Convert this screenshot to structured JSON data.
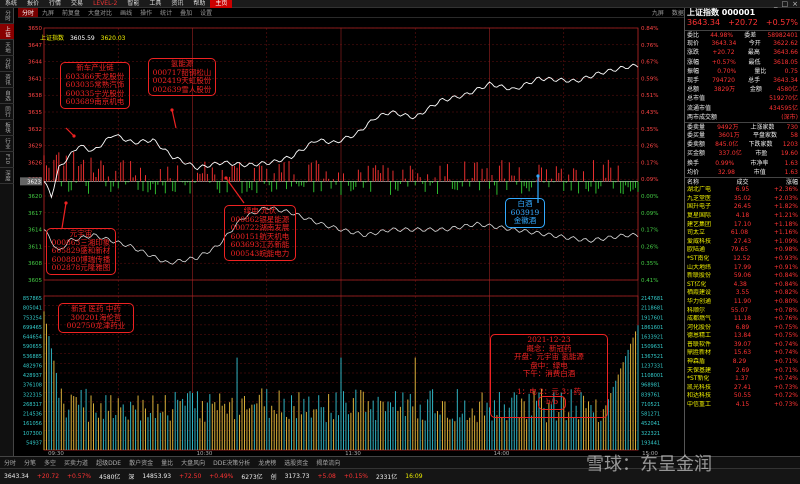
{
  "menubar": {
    "items": [
      "系统",
      "报价",
      "行情",
      "交易",
      "LEVEL-2",
      "智能",
      "工具",
      "资讯",
      "帮助",
      "主页"
    ],
    "controls": [
      "_",
      "□",
      "×"
    ]
  },
  "toolbar": {
    "items": [
      "分时",
      "九屏",
      "前复盘",
      "大盘对比",
      "画线",
      "操作",
      "统计",
      "叠加",
      "设置"
    ],
    "right_items": [
      "九屏",
      "数据备基",
      "大盘对比",
      "画线",
      "简单自选",
      "沙"
    ]
  },
  "leftbar": {
    "items": [
      "分时",
      "上证指数",
      "天地",
      "分析",
      "资讯",
      "自选",
      "同行",
      "板块",
      "行业",
      "F10",
      "深度"
    ]
  },
  "ticker": {
    "name": "上证指数",
    "parts": [
      "3605.59",
      "3620.03"
    ]
  },
  "price_axis": {
    "left": [
      "3650",
      "3647",
      "3644",
      "3641",
      "3638",
      "3635",
      "3632",
      "3629",
      "3626",
      "3623",
      "3620",
      "3617",
      "3614",
      "3611",
      "3608",
      "3605"
    ],
    "right": [
      "0.84%",
      "0.76%",
      "0.67%",
      "0.59%",
      "0.51%",
      "0.43%",
      "0.35%",
      "0.26%",
      "0.17%",
      "0.09%",
      "0.00%",
      "0.09%",
      "0.17%",
      "0.26%",
      "0.35%",
      "0.41%"
    ],
    "highlight": "3623"
  },
  "volume_axis": {
    "left": [
      "857865",
      "805041",
      "753254",
      "699465",
      "644654",
      "590655",
      "536885",
      "482976",
      "428937",
      "376108",
      "322315",
      "268317",
      "214536",
      "161056",
      "107300",
      "54937"
    ],
    "right": [
      "2147681",
      "2118681",
      "1917601",
      "1861601",
      "1633921",
      "1509631",
      "1367521",
      "1237331",
      "1108001",
      "968981",
      "839761",
      "710521",
      "581271",
      "452041",
      "322321",
      "193441"
    ]
  },
  "time_axis": [
    "09:30",
    "10:30",
    "11:30",
    "14:00",
    "15:00"
  ],
  "annotations": {
    "car": "新车产业链\n603366天龙股份\n603035常熟汽饰\n600335宁光股份\n603689南京机电",
    "hydrogen": "氢能源\n000717韶钢松山\n002419天虹股份\n002639雪人股份",
    "metaverse": "元宇宙\n000863三湘印象\n605829盛和新材\n600880博瑞传播\n002878元隆雅图",
    "pharma": "新冠 医药 中药\n300201海伦哲\n002750龙津药业",
    "green": "绿电 光伏\n000862银星能源\n000722湖南发展\n600151航天机电\n603693江苏新能\n000543皖能电力",
    "baijiu": "白酒\n603919\n金徽酒",
    "summary": "2021-12-23\n概念：新冠药\n开盘：元宇宙 氢能源\n盘中：绿电\n下午：消费白酒\n\n1：电 2：元 3：药",
    "page": "b/b"
  },
  "right_panel": {
    "title": "上证指数 000001",
    "price": "3643.34",
    "change": "+20.72",
    "pct": "+0.57%",
    "rows": [
      {
        "l": "委比",
        "lv": "44.98%",
        "r": "委差",
        "rv": "58982401"
      },
      {
        "l": "现价",
        "lv": "3643.34",
        "r": "今开",
        "rv": "3622.62"
      },
      {
        "l": "涨跌",
        "lv": "+20.72",
        "r": "最高",
        "rv": "3643.66"
      },
      {
        "l": "涨幅",
        "lv": "+0.57%",
        "r": "最低",
        "rv": "3618.05"
      },
      {
        "l": "振幅",
        "lv": "0.70%",
        "r": "量比",
        "rv": "0.75"
      },
      {
        "l": "现手",
        "lv": "794720",
        "r": "总手",
        "rv": "3643.34"
      },
      {
        "l": "总额",
        "lv": "3829万",
        "r": "金额",
        "rv": "4580亿"
      },
      {
        "l": "总市值",
        "lv": "",
        "r": "",
        "rv": "519270亿"
      },
      {
        "l": "流通市值",
        "lv": "",
        "r": "",
        "rv": "434595亿"
      },
      {
        "l": "两市成交额",
        "lv": "",
        "r": "",
        "rv": "(深市)"
      }
    ],
    "stats": [
      {
        "l": "委卖量",
        "lv": "9492万",
        "r": "上涨家数",
        "rv": "730"
      },
      {
        "l": "委买量",
        "lv": "3601万",
        "r": "平盘家数",
        "rv": "58"
      },
      {
        "l": "委卖额",
        "lv": "845.0亿",
        "r": "下跌家数",
        "rv": "1203"
      },
      {
        "l": "买金额",
        "lv": "337.0亿",
        "r": "市盈",
        "rv": "19.60"
      },
      {
        "l": "换手",
        "lv": "0.99%",
        "r": "市净率",
        "rv": "1.63"
      },
      {
        "l": "均价",
        "lv": "32.98",
        "r": "市值",
        "rv": "1.63"
      }
    ],
    "list_header": [
      "名称",
      "成交",
      "涨幅"
    ],
    "list": [
      {
        "n": "湖北广电",
        "v": "6.95",
        "p": "+2.36%"
      },
      {
        "n": "九芝堂医",
        "v": "35.02",
        "p": "+2.03%"
      },
      {
        "n": "国升电子",
        "v": "26.45",
        "p": "+1.82%"
      },
      {
        "n": "复星国际",
        "v": "4.18",
        "p": "+1.21%"
      },
      {
        "n": "建艺集团",
        "v": "17.10",
        "p": "+1.18%"
      },
      {
        "n": "司太立",
        "v": "61.08",
        "p": "+1.16%"
      },
      {
        "n": "爱威科技",
        "v": "27.43",
        "p": "+1.09%"
      },
      {
        "n": "欧陆通",
        "v": "79.65",
        "p": "+0.98%"
      },
      {
        "n": "*ST南化",
        "v": "12.52",
        "p": "+0.93%"
      },
      {
        "n": "山大地纬",
        "v": "17.99",
        "p": "+0.91%"
      },
      {
        "n": "新联股份",
        "v": "59.06",
        "p": "+0.84%"
      },
      {
        "n": "ST亿化",
        "v": "4.38",
        "p": "+0.84%"
      },
      {
        "n": "栖霞建设",
        "v": "3.55",
        "p": "+0.82%"
      },
      {
        "n": "华力创通",
        "v": "11.90",
        "p": "+0.80%"
      },
      {
        "n": "科顺尔",
        "v": "55.07",
        "p": "+0.78%"
      },
      {
        "n": "成都燃气",
        "v": "11.18",
        "p": "+0.76%"
      },
      {
        "n": "河化股份",
        "v": "6.89",
        "p": "+0.75%"
      },
      {
        "n": "德恩精工",
        "v": "13.84",
        "p": "+0.75%"
      },
      {
        "n": "普联软件",
        "v": "39.07",
        "p": "+0.74%"
      },
      {
        "n": "鼎胜新材",
        "v": "15.63",
        "p": "+0.74%"
      },
      {
        "n": "神森盾",
        "v": "8.29",
        "p": "+0.71%"
      },
      {
        "n": "天保基建",
        "v": "2.69",
        "p": "+0.71%"
      },
      {
        "n": "*ST新化",
        "v": "1.37",
        "p": "+0.74%"
      },
      {
        "n": "凯光科技",
        "v": "27.41",
        "p": "+0.73%"
      },
      {
        "n": "和达科技",
        "v": "50.55",
        "p": "+0.72%"
      },
      {
        "n": "中信重工",
        "v": "4.15",
        "p": "+0.73%"
      }
    ]
  },
  "bottom_tabs": [
    "分时",
    "分笔",
    "多空",
    "买卖力道",
    "超级DDE",
    "散户资金",
    "量比",
    "大盘风向",
    "DDE决策分析",
    "龙虎榜",
    "选股资金",
    "揭单流向"
  ],
  "status": {
    "items": [
      {
        "t": "3643.34",
        "c": "white"
      },
      {
        "t": "+20.72",
        "c": "red"
      },
      {
        "t": "+0.57%",
        "c": "red"
      },
      {
        "t": "4580亿",
        "c": "white"
      },
      {
        "t": "深",
        "c": "white"
      },
      {
        "t": "14853.93",
        "c": "white"
      },
      {
        "t": "+72.50",
        "c": "red"
      },
      {
        "t": "+0.49%",
        "c": "red"
      },
      {
        "t": "6273亿",
        "c": "white"
      },
      {
        "t": "创",
        "c": "white"
      },
      {
        "t": "3173.73",
        "c": "white"
      },
      {
        "t": "+5.08",
        "c": "red"
      },
      {
        "t": "+0.15%",
        "c": "red"
      },
      {
        "t": "2331亿",
        "c": "white"
      },
      {
        "t": "16:09",
        "c": "yellow"
      }
    ]
  },
  "watermark": "雪球：东呈金润",
  "colors": {
    "up": "#ff3333",
    "down": "#33cc33",
    "line_price": "#ffffff",
    "line_avg": "#ffff00",
    "grid": "#661111"
  },
  "chart_data": {
    "type": "line",
    "x_unit": "minute index 0-240",
    "ylim": [
      3605,
      3650
    ],
    "prev_close": 3622.62,
    "price": [
      [
        0,
        3622.6
      ],
      [
        3,
        3620
      ],
      [
        6,
        3625
      ],
      [
        10,
        3627
      ],
      [
        14,
        3629
      ],
      [
        20,
        3628
      ],
      [
        28,
        3631
      ],
      [
        36,
        3629.5
      ],
      [
        44,
        3630
      ],
      [
        52,
        3627
      ],
      [
        62,
        3625
      ],
      [
        72,
        3626
      ],
      [
        82,
        3625.5
      ],
      [
        92,
        3626
      ],
      [
        100,
        3627
      ],
      [
        110,
        3630
      ],
      [
        118,
        3629.5
      ],
      [
        120,
        3630
      ],
      [
        126,
        3631
      ],
      [
        134,
        3634
      ],
      [
        140,
        3635
      ],
      [
        150,
        3634
      ],
      [
        160,
        3637
      ],
      [
        170,
        3638
      ],
      [
        180,
        3640
      ],
      [
        190,
        3639
      ],
      [
        200,
        3641
      ],
      [
        215,
        3640.5
      ],
      [
        225,
        3642
      ],
      [
        235,
        3643
      ],
      [
        240,
        3643.3
      ]
    ],
    "avg": [
      [
        0,
        3614
      ],
      [
        6,
        3610
      ],
      [
        10,
        3612
      ],
      [
        20,
        3613
      ],
      [
        35,
        3611
      ],
      [
        50,
        3608
      ],
      [
        62,
        3609
      ],
      [
        70,
        3611
      ],
      [
        80,
        3616
      ],
      [
        90,
        3618
      ],
      [
        100,
        3617
      ],
      [
        112,
        3615
      ],
      [
        120,
        3614
      ],
      [
        130,
        3613
      ],
      [
        140,
        3614
      ],
      [
        150,
        3614
      ],
      [
        162,
        3614
      ],
      [
        175,
        3615
      ],
      [
        190,
        3614
      ],
      [
        205,
        3613
      ],
      [
        220,
        3612
      ],
      [
        235,
        3613
      ],
      [
        240,
        3613
      ]
    ],
    "volume_seed": 23
  }
}
